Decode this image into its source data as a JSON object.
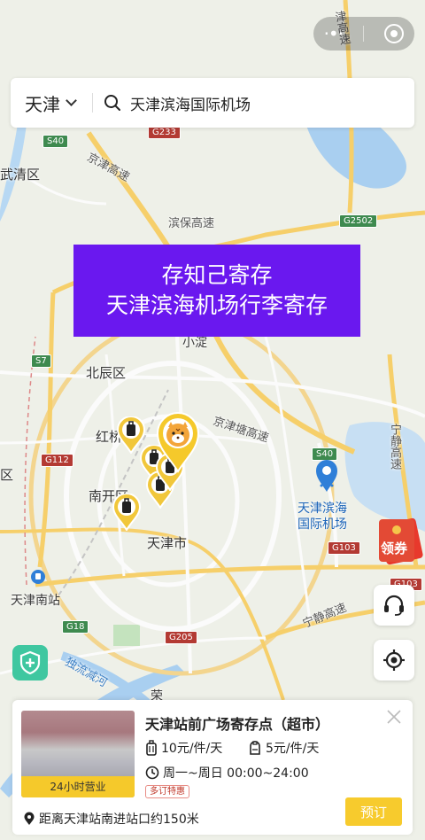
{
  "map": {
    "labels": {
      "wuqing": "武清区",
      "beichen": "北辰区",
      "hongqiao": "红桥",
      "nankai": "南开区",
      "tianjin_city": "天津市",
      "tianjin_south": "天津南站",
      "xiaodian": "小淀",
      "airport": "天津滨海\n国际机场",
      "qu_left": "区",
      "rong": "荣"
    },
    "roads": {
      "jinghu": "京津高速",
      "binbao": "滨保高速",
      "jingjintang": "京津塘高速",
      "ningjing": "宁静高速",
      "ningjing_v": "宁静高速",
      "jin_top": "津高速",
      "duliu": "独流减河"
    },
    "shields": [
      "S40",
      "G233",
      "G2502",
      "S7",
      "G112",
      "S40",
      "G103",
      "G103",
      "G18",
      "G205"
    ]
  },
  "banner": {
    "line1": "存知己寄存",
    "line2": "天津滨海机场行李寄存"
  },
  "search": {
    "city": "天津",
    "value": "天津滨海国际机场"
  },
  "coupon_label": "领券",
  "card": {
    "title": "天津站前广场寄存点（超市）",
    "photo_badge": "24小时营业",
    "price_large": "10元/件/天",
    "price_small": "5元/件/天",
    "hours": "周一~周日 00:00~24:00",
    "tag": "多订特惠",
    "distance": "距离天津站南进站口约150米",
    "book": "预订"
  },
  "colors": {
    "banner": "#6a18ef",
    "accent_yellow": "#f7cb2d",
    "airport_pin": "#2f7fd8"
  }
}
